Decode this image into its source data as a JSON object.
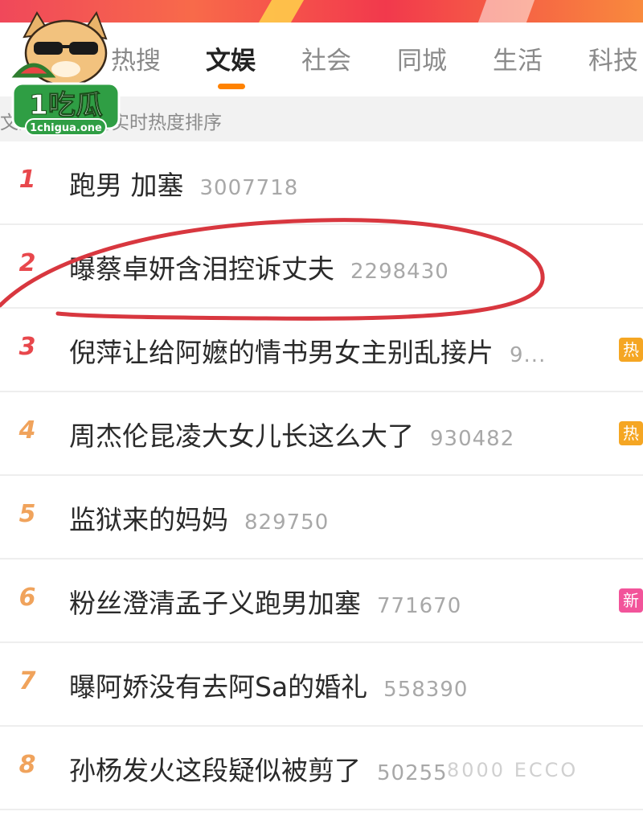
{
  "tabs": [
    {
      "label": "热搜",
      "active": false
    },
    {
      "label": "文娱",
      "active": true
    },
    {
      "label": "社会",
      "active": false
    },
    {
      "label": "同城",
      "active": false
    },
    {
      "label": "生活",
      "active": false
    },
    {
      "label": "科技",
      "active": false
    }
  ],
  "subheader": {
    "text": "文娱榜按圈内实时热度排序"
  },
  "rank_colors": {
    "top3": "#e8474c",
    "rest": "#f0a35c"
  },
  "accent": "#ff8200",
  "items": [
    {
      "rank": "1",
      "title": "跑男 加塞",
      "count": "3007718",
      "badge": null
    },
    {
      "rank": "2",
      "title": "曝蔡卓妍含泪控诉丈夫",
      "count": "2298430",
      "badge": null
    },
    {
      "rank": "3",
      "title": "倪萍让给阿嬷的情书男女主别乱接片",
      "count": "9...",
      "badge": {
        "text": "热",
        "color": "#f5a623"
      }
    },
    {
      "rank": "4",
      "title": "周杰伦昆凌大女儿长这么大了",
      "count": "930482",
      "badge": {
        "text": "热",
        "color": "#f5a623"
      }
    },
    {
      "rank": "5",
      "title": "监狱来的妈妈",
      "count": "829750",
      "badge": null
    },
    {
      "rank": "6",
      "title": "粉丝澄清孟子义跑男加塞",
      "count": "771670",
      "badge": {
        "text": "新",
        "color": "#f2549a"
      }
    },
    {
      "rank": "7",
      "title": "曝阿娇没有去阿Sa的婚礼",
      "count": "558390",
      "badge": null
    },
    {
      "rank": "8",
      "title": "孙杨发火这段疑似被剪了",
      "count": "50255",
      "badge": null
    }
  ],
  "logo": {
    "text": "1吃瓜",
    "domain": "1chigua.one"
  },
  "watermark": {
    "text": "8000 ECCO"
  }
}
